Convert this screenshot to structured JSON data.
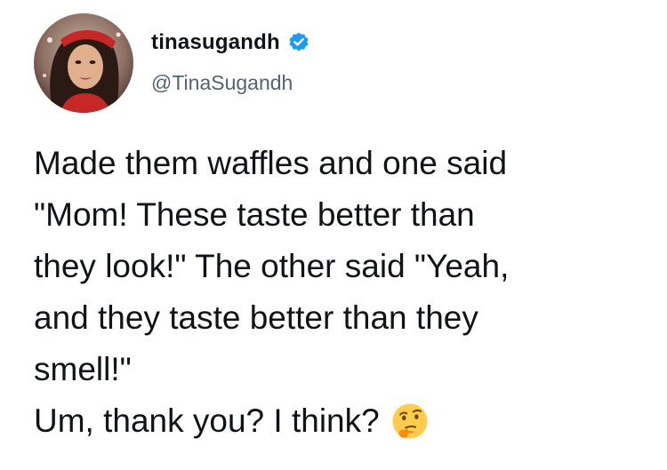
{
  "author": {
    "display_name": "tinasugandh",
    "handle": "@TinaSugandh",
    "verified": true,
    "verified_icon": "verified-badge-icon",
    "avatar_icon": "profile-photo"
  },
  "tweet": {
    "text": "Made them waffles and one said\n\"Mom! These taste better than\nthey look!\" The other said \"Yeah,\nand they taste better than they\nsmell!\"",
    "closing_text": "Um, thank you? I think?",
    "emoji": "thinking-face-icon"
  },
  "colors": {
    "text": "#0f1419",
    "handle": "#536471",
    "verified": "#1d9bf0",
    "emoji": "#ffcc4d"
  }
}
